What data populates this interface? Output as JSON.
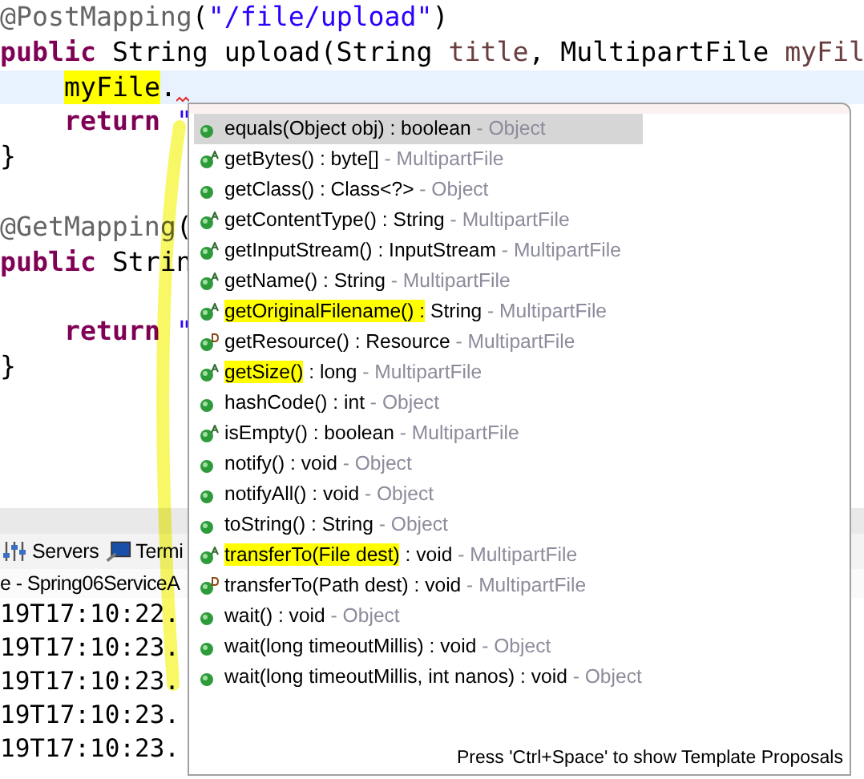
{
  "code_lines": [
    {
      "tokens": [
        {
          "text": "@PostMapping",
          "kind": "annotation"
        },
        {
          "text": "(",
          "kind": "plain"
        },
        {
          "text": "\"/file/upload\"",
          "kind": "string"
        },
        {
          "text": ")",
          "kind": "plain"
        }
      ]
    },
    {
      "tokens": [
        {
          "text": "public",
          "kind": "keyword"
        },
        {
          "text": " String upload(String ",
          "kind": "plain"
        },
        {
          "text": "title",
          "kind": "param"
        },
        {
          "text": ", MultipartFile ",
          "kind": "plain"
        },
        {
          "text": "myFil",
          "kind": "param"
        }
      ]
    },
    {
      "indented": true,
      "current": true,
      "error": true,
      "tokens": [
        {
          "text": "myFile",
          "kind": "plain",
          "highlighted": true
        },
        {
          "text": ".",
          "kind": "plain"
        }
      ]
    },
    {
      "indented": true,
      "tokens": [
        {
          "text": "return",
          "kind": "keyword"
        },
        {
          "text": " \"",
          "kind": "string"
        }
      ]
    },
    {
      "tokens": [
        {
          "text": "}",
          "kind": "plain"
        }
      ]
    },
    {
      "kind": "blank"
    },
    {
      "tokens": [
        {
          "text": "@GetMapping",
          "kind": "annotation"
        },
        {
          "text": "(",
          "kind": "plain"
        }
      ]
    },
    {
      "tokens": [
        {
          "text": "public",
          "kind": "keyword"
        },
        {
          "text": " Strin",
          "kind": "plain"
        }
      ]
    },
    {
      "kind": "blank"
    },
    {
      "indented": true,
      "tokens": [
        {
          "text": "return",
          "kind": "keyword"
        },
        {
          "text": " \"",
          "kind": "string"
        }
      ]
    },
    {
      "tokens": [
        {
          "text": "}",
          "kind": "plain"
        }
      ]
    }
  ],
  "console": {
    "tabs": [
      {
        "label": "Servers"
      },
      {
        "label": "Termi"
      }
    ],
    "header": "e - Spring06ServiceA",
    "lines": [
      "19T17:10:22.",
      "19T17:10:23.",
      "19T17:10:23.",
      "19T17:10:23.",
      "19T17:10:23."
    ]
  },
  "completion": {
    "items": [
      {
        "kind": "public",
        "name": "equals(Object obj)",
        "type": " : boolean",
        "owner": "- Object",
        "selected": true,
        "highlighted": false
      },
      {
        "kind": "abstract",
        "name": "getBytes()",
        "type": " : byte[]",
        "owner": "- MultipartFile",
        "selected": false,
        "highlighted": false
      },
      {
        "kind": "public",
        "name": "getClass()",
        "type": " : Class<?>",
        "owner": "- Object",
        "selected": false,
        "highlighted": false
      },
      {
        "kind": "abstract",
        "name": "getContentType()",
        "type": " : String",
        "owner": "- MultipartFile",
        "selected": false,
        "highlighted": false
      },
      {
        "kind": "abstract",
        "name": "getInputStream()",
        "type": " : InputStream",
        "owner": "- MultipartFile",
        "selected": false,
        "highlighted": false
      },
      {
        "kind": "abstract",
        "name": "getName()",
        "type": " : String",
        "owner": "- MultipartFile",
        "selected": false,
        "highlighted": false
      },
      {
        "kind": "abstract",
        "name": "getOriginalFilename() :",
        "type": " String",
        "owner": "- MultipartFile",
        "selected": false,
        "highlighted": true
      },
      {
        "kind": "default",
        "name": "getResource()",
        "type": " : Resource",
        "owner": "- MultipartFile",
        "selected": false,
        "highlighted": false
      },
      {
        "kind": "abstract",
        "name": "getSize()",
        "type": " : long",
        "owner": "- MultipartFile",
        "selected": false,
        "highlighted": true
      },
      {
        "kind": "public",
        "name": "hashCode()",
        "type": " : int",
        "owner": "- Object",
        "selected": false,
        "highlighted": false
      },
      {
        "kind": "abstract",
        "name": "isEmpty()",
        "type": " : boolean",
        "owner": "- MultipartFile",
        "selected": false,
        "highlighted": false
      },
      {
        "kind": "public",
        "name": "notify()",
        "type": " : void",
        "owner": "- Object",
        "selected": false,
        "highlighted": false
      },
      {
        "kind": "public",
        "name": "notifyAll()",
        "type": " : void",
        "owner": "- Object",
        "selected": false,
        "highlighted": false
      },
      {
        "kind": "public",
        "name": "toString()",
        "type": " : String",
        "owner": "- Object",
        "selected": false,
        "highlighted": false
      },
      {
        "kind": "abstract",
        "name": "transferTo(File dest)",
        "type": " : void",
        "owner": "- MultipartFile",
        "selected": false,
        "highlighted": true
      },
      {
        "kind": "default",
        "name": "transferTo(Path dest)",
        "type": " : void",
        "owner": "- MultipartFile",
        "selected": false,
        "highlighted": false
      },
      {
        "kind": "public",
        "name": "wait()",
        "type": " : void",
        "owner": "- Object",
        "selected": false,
        "highlighted": false
      },
      {
        "kind": "public",
        "name": "wait(long timeoutMillis)",
        "type": " : void",
        "owner": "- Object",
        "selected": false,
        "highlighted": false
      },
      {
        "kind": "public",
        "name": "wait(long timeoutMillis, int nanos)",
        "type": " : void",
        "owner": "- Object",
        "selected": false,
        "highlighted": false
      }
    ],
    "footer": "Press 'Ctrl+Space' to show Template Proposals"
  }
}
